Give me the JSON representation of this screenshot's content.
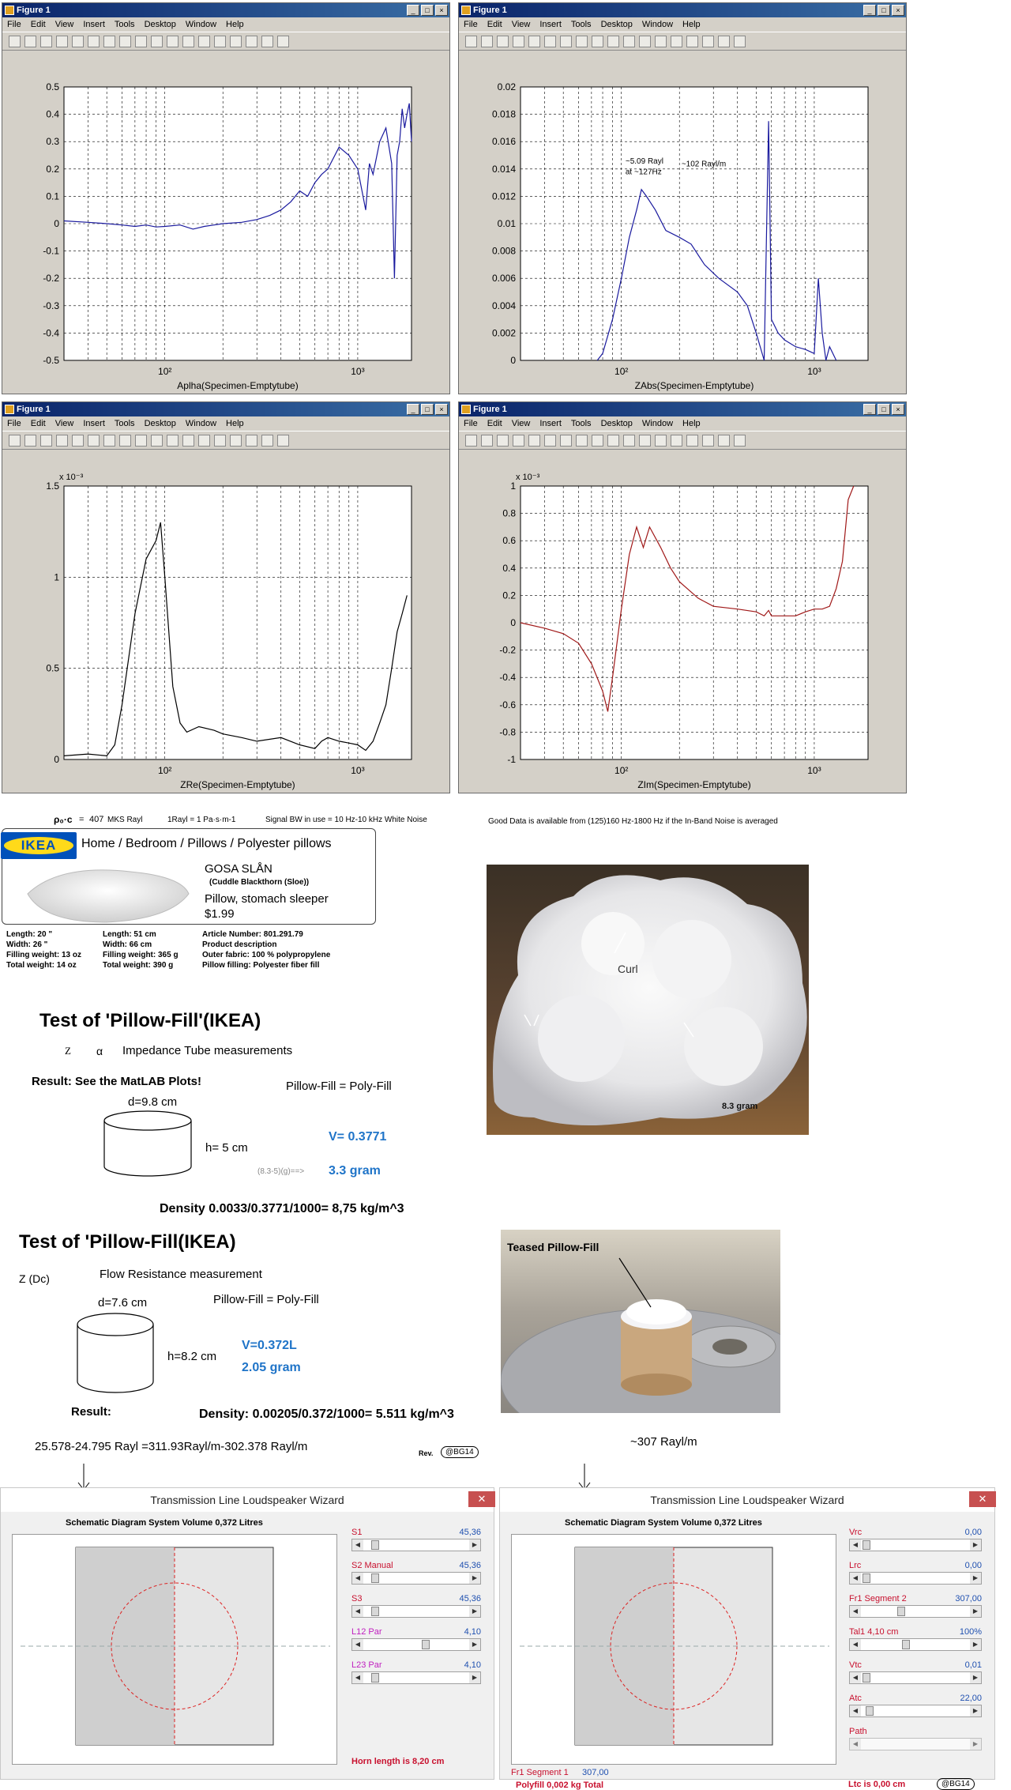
{
  "figures": {
    "window_title": "Figure 1",
    "menu": [
      "File",
      "Edit",
      "View",
      "Insert",
      "Tools",
      "Desktop",
      "Window",
      "Help"
    ],
    "fig1": {
      "xlabel": "Aplha(Specimen-Emptytube)",
      "yticks": [
        "0.5",
        "0.4",
        "0.3",
        "0.2",
        "0.1",
        "0",
        "-0.1",
        "-0.2",
        "-0.3",
        "-0.4",
        "-0.5"
      ],
      "xticks": [
        "10²",
        "10³"
      ]
    },
    "fig2": {
      "xlabel": "ZAbs(Specimen-Emptytube)",
      "yticks": [
        "0.02",
        "0.018",
        "0.016",
        "0.014",
        "0.012",
        "0.01",
        "0.008",
        "0.006",
        "0.004",
        "0.002",
        "0"
      ],
      "xticks": [
        "10²",
        "10³"
      ],
      "annotation1": "~5.09 Rayl",
      "annotation2": "at ~127Hz",
      "annotation3": "~102 Rayl/m"
    },
    "fig3": {
      "xlabel": "ZRe(Specimen-Emptytube)",
      "yticks": [
        "1.5",
        "1",
        "0.5",
        "0"
      ],
      "exponent": "x 10⁻³",
      "xticks": [
        "10²",
        "10³"
      ]
    },
    "fig4": {
      "xlabel": "ZIm(Specimen-Emptytube)",
      "yticks": [
        "1",
        "0.8",
        "0.6",
        "0.4",
        "0.2",
        "0",
        "-0.2",
        "-0.4",
        "-0.6",
        "-0.8",
        "-1"
      ],
      "exponent": "x 10⁻³",
      "xticks": [
        "10²",
        "10³"
      ]
    }
  },
  "chart_data": [
    {
      "type": "line",
      "xlabel": "Aplha(Specimen-Emptytube)",
      "xscale": "log",
      "xlim": [
        30,
        1900
      ],
      "ylim": [
        -0.5,
        0.5
      ],
      "grid": true,
      "series": [
        {
          "color": "#1a1a9e",
          "x": [
            30,
            40,
            50,
            60,
            70,
            80,
            90,
            100,
            120,
            140,
            160,
            180,
            200,
            250,
            300,
            350,
            400,
            450,
            500,
            550,
            600,
            650,
            700,
            800,
            900,
            1000,
            1100,
            1150,
            1200,
            1300,
            1400,
            1500,
            1550,
            1600,
            1650,
            1700,
            1750,
            1800,
            1850,
            1900
          ],
          "y": [
            0.01,
            0.005,
            0,
            -0.005,
            -0.01,
            -0.005,
            -0.012,
            -0.01,
            -0.005,
            -0.02,
            -0.01,
            -0.005,
            0,
            0.005,
            0.015,
            0.03,
            0.05,
            0.08,
            0.12,
            0.1,
            0.15,
            0.18,
            0.2,
            0.28,
            0.25,
            0.2,
            0.05,
            0.22,
            0.18,
            0.3,
            0.35,
            0.22,
            -0.2,
            0.25,
            0.3,
            0.42,
            0.35,
            0.4,
            0.44,
            0.3
          ]
        }
      ]
    },
    {
      "type": "line",
      "xlabel": "ZAbs(Specimen-Emptytube)",
      "xscale": "log",
      "xlim": [
        30,
        1900
      ],
      "ylim": [
        0,
        0.02
      ],
      "grid": true,
      "series": [
        {
          "color": "#1a1a9e",
          "x": [
            75,
            80,
            90,
            100,
            110,
            120,
            127,
            135,
            150,
            170,
            200,
            230,
            270,
            320,
            400,
            450,
            500,
            550,
            580,
            600,
            650,
            700,
            800,
            900,
            1000,
            1050,
            1100,
            1150,
            1200,
            1300
          ],
          "y": [
            0,
            0.0005,
            0.003,
            0.006,
            0.009,
            0.011,
            0.0125,
            0.012,
            0.011,
            0.0095,
            0.009,
            0.0085,
            0.007,
            0.006,
            0.005,
            0.004,
            0.002,
            0,
            0.0175,
            0.003,
            0.002,
            0.0015,
            0.001,
            0.0008,
            0.0005,
            0.006,
            0.002,
            0,
            0.001,
            0
          ]
        }
      ]
    },
    {
      "type": "line",
      "xlabel": "ZRe(Specimen-Emptytube)",
      "xscale": "log",
      "xlim": [
        30,
        1900
      ],
      "ylim": [
        0,
        0.0015
      ],
      "grid": true,
      "series": [
        {
          "color": "#000",
          "x": [
            30,
            40,
            50,
            55,
            60,
            70,
            80,
            90,
            95,
            100,
            110,
            120,
            130,
            150,
            180,
            200,
            250,
            300,
            400,
            500,
            600,
            650,
            700,
            800,
            900,
            1000,
            1100,
            1200,
            1300,
            1400,
            1500,
            1600,
            1700,
            1800
          ],
          "y": [
            2e-05,
            3e-05,
            2e-05,
            8e-05,
            0.0003,
            0.0008,
            0.0011,
            0.0012,
            0.0013,
            0.001,
            0.0004,
            0.0002,
            0.00015,
            0.00018,
            0.00016,
            0.00014,
            0.00012,
            0.0001,
            0.00012,
            8e-05,
            6e-05,
            0.0001,
            0.00012,
            0.0001,
            9e-05,
            8e-05,
            5e-05,
            0.0001,
            0.0002,
            0.0003,
            0.0005,
            0.0007,
            0.0008,
            0.0009
          ]
        }
      ]
    },
    {
      "type": "line",
      "xlabel": "ZIm(Specimen-Emptytube)",
      "xscale": "log",
      "xlim": [
        30,
        1900
      ],
      "ylim": [
        -0.001,
        0.001
      ],
      "grid": true,
      "series": [
        {
          "color": "#a01818",
          "x": [
            30,
            40,
            50,
            60,
            70,
            80,
            85,
            90,
            100,
            110,
            120,
            130,
            140,
            160,
            180,
            200,
            250,
            300,
            400,
            500,
            550,
            580,
            600,
            700,
            800,
            900,
            1000,
            1100,
            1200,
            1300,
            1400,
            1500,
            1600
          ],
          "y": [
            0,
            -4e-05,
            -8e-05,
            -0.00015,
            -0.0003,
            -0.0005,
            -0.00065,
            -0.0004,
            0.0001,
            0.0005,
            0.0007,
            0.00055,
            0.0007,
            0.00055,
            0.0004,
            0.0003,
            0.00018,
            0.00012,
            0.0001,
            8e-05,
            5e-05,
            9e-05,
            5e-05,
            5e-05,
            5e-05,
            8e-05,
            0.0001,
            0.0001,
            0.00012,
            0.00025,
            0.00045,
            0.0009,
            0.001
          ]
        }
      ]
    }
  ],
  "formulas": {
    "rho_c": "ρ₀·c",
    "rho_eq": "=",
    "rho_val": "407",
    "rho_unit": "MKS Rayl",
    "rayl_def": "1Rayl = 1  Pa·s·m-1",
    "bw": "Signal BW in use = 10 Hz-10 kHz White Noise",
    "good_data": "Good Data is available from (125)160 Hz-1800 Hz if the In-Band Noise  is averaged"
  },
  "ikea": {
    "logo": "IKEA",
    "breadcrumb": "Home  /  Bedroom  /  Pillows  /  Polyester pillows",
    "name": "GOSA SLÅN",
    "subname": "(Cuddle Blackthorn (Sloe))",
    "desc": "Pillow, stomach sleeper",
    "price": "$1.99",
    "col1": [
      "Length: 20 \"",
      "Width: 26 \"",
      "Filling weight: 13 oz",
      "Total weight: 14 oz"
    ],
    "col2": [
      "Length: 51 cm",
      "Width: 66 cm",
      "Filling weight: 365 g",
      "Total weight: 390 g"
    ],
    "col3": [
      "Article Number: 801.291.79",
      "Product description",
      "Outer fabric: 100 % polypropylene",
      "Pillow filling: Polyester fiber fill"
    ]
  },
  "test1": {
    "title": "Test of 'Pillow-Fill'(IKEA)",
    "z": "Z",
    "alpha": "α",
    "subtitle": "Impedance Tube measurements",
    "result": "Result: See the MatLAB Plots!",
    "fill": "Pillow-Fill = Poly-Fill",
    "d": "d=9.8 cm",
    "h": "h= 5 cm",
    "v": "V= 0.3771",
    "calc": "(8.3-5)(g)==>",
    "gram": "3.3 gram",
    "density": "Density    0.0033/0.3771/1000= 8,75 kg/m^3"
  },
  "photo1": {
    "curl": "Curl",
    "gram": "8.3 gram"
  },
  "test2": {
    "title": "Test of 'Pillow-Fill(IKEA)",
    "zdc": "Z (Dc)",
    "subtitle": "Flow Resistance measurement",
    "d": "d=7.6 cm",
    "fill": "Pillow-Fill = Poly-Fill",
    "h": "h=8.2  cm",
    "v": "V=0.372L",
    "gram": "2.05 gram",
    "result": "Result:",
    "density": "Density: 0.00205/0.372/1000= 5.511 kg/m^3",
    "calc": "25.578-24.795 Rayl =311.93Rayl/m-302.378 Rayl/m",
    "rev": "Rev.",
    "badge": "@BG14"
  },
  "photo2": {
    "label": "Teased Pillow-Fill",
    "below": "~307 Rayl/m"
  },
  "wizard1": {
    "title": "Transmission Line Loudspeaker Wizard",
    "close": "✕",
    "cap": "Schematic Diagram    System Volume 0,372 Litres",
    "sliders": [
      {
        "label": "S1",
        "value": "45,36"
      },
      {
        "label": "S2  Manual",
        "value": "45,36"
      },
      {
        "label": "S3",
        "value": "45,36"
      },
      {
        "label": "L12  Par",
        "value": "4,10"
      },
      {
        "label": "L23  Par",
        "value": "4,10"
      }
    ],
    "footer": "Horn length is 8,20 cm"
  },
  "wizard2": {
    "title": "Transmission Line Loudspeaker Wizard",
    "close": "✕",
    "cap": "Schematic Diagram    System Volume 0,372 Litres",
    "sliders": [
      {
        "label": "Vrc",
        "value": "0,00"
      },
      {
        "label": "Lrc",
        "value": "0,00"
      },
      {
        "label": "Fr1  Segment 2",
        "value": "307,00"
      },
      {
        "label": "Tal1   4,10 cm",
        "value": "100%"
      },
      {
        "label": "Vtc",
        "value": "0,01"
      },
      {
        "label": "Atc",
        "value": "22,00"
      },
      {
        "label": "Path",
        "value": ""
      }
    ],
    "fr1": "Fr1  Segment 1",
    "fr1val": "307,00",
    "polyfill": "Polyfill     0,002 kg    Total",
    "ltc": "Ltc is 0,00 cm",
    "badge": "@BG14"
  }
}
